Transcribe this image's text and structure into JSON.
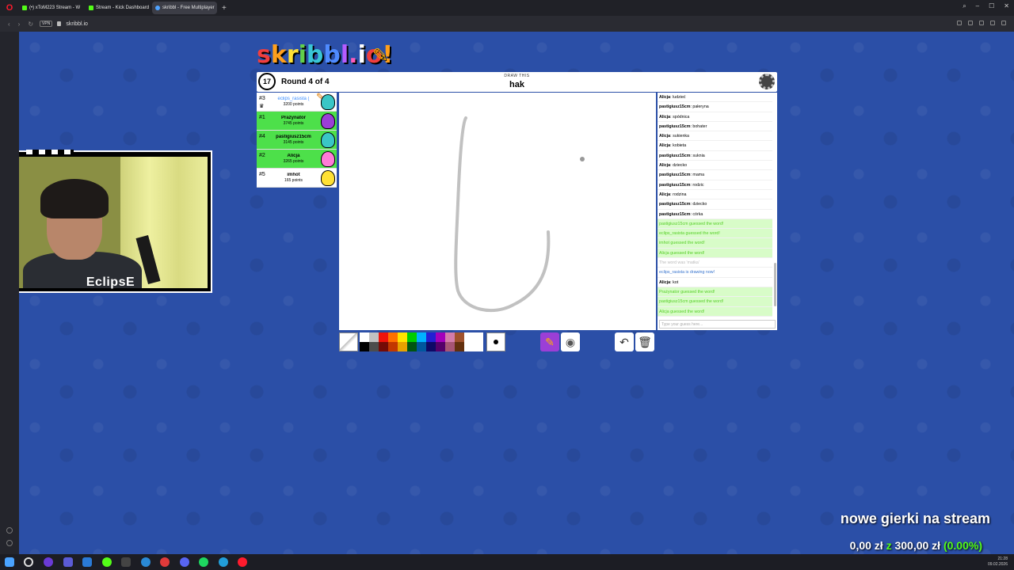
{
  "browser": {
    "tabs": [
      {
        "title": "(•) xToM223 Stream - W",
        "active": false
      },
      {
        "title": "Stream - Kick Dashboard",
        "active": false
      },
      {
        "title": "skribbl - Free Multiplayer",
        "active": true
      }
    ],
    "new_tab": "+",
    "vpn_label": "VPN",
    "url": "skribbl.io"
  },
  "game": {
    "logo_text": "skribbl.io",
    "timer": "17",
    "round_text": "Round 4 of 4",
    "draw_this_label": "DRAW THIS",
    "word": "hak",
    "players": [
      {
        "rank": "#3",
        "name": "eclips_rasista (",
        "points": "3200 points",
        "me": true,
        "drawing": true,
        "guessed": false,
        "avatar_color": "#3ac6c6"
      },
      {
        "rank": "#1",
        "name": "Prażynator",
        "points": "3745 points",
        "me": false,
        "drawing": false,
        "guessed": true,
        "avatar_color": "#9b3fd6"
      },
      {
        "rank": "#4",
        "name": "pastigiusz15cm",
        "points": "3145 points",
        "me": false,
        "drawing": false,
        "guessed": true,
        "avatar_color": "#3ac6c6"
      },
      {
        "rank": "#2",
        "name": "Alicja",
        "points": "3265 points",
        "me": false,
        "drawing": false,
        "guessed": true,
        "avatar_color": "#ff7bd6"
      },
      {
        "rank": "#5",
        "name": "imhot",
        "points": "165 points",
        "me": false,
        "drawing": false,
        "guessed": false,
        "avatar_color": "#ffe135"
      }
    ],
    "chat": [
      {
        "user": "Alicja",
        "text": "ludzieć",
        "type": "normal"
      },
      {
        "user": "pastigiusz15cm",
        "text": "pałeryna",
        "type": "normal"
      },
      {
        "user": "Alicja",
        "text": "spódnica",
        "type": "normal"
      },
      {
        "user": "pastigiusz15cm",
        "text": "bohater",
        "type": "normal"
      },
      {
        "user": "Alicja",
        "text": "sukienka",
        "type": "normal"
      },
      {
        "user": "Alicja",
        "text": "kobieta",
        "type": "normal"
      },
      {
        "user": "pastigiusz15cm",
        "text": "suknia",
        "type": "normal"
      },
      {
        "user": "Alicja",
        "text": "dziecko",
        "type": "normal"
      },
      {
        "user": "pastigiusz15cm",
        "text": "mama",
        "type": "normal"
      },
      {
        "user": "pastigiusz15cm",
        "text": "rodzic",
        "type": "normal"
      },
      {
        "user": "Alicja",
        "text": "rodzina",
        "type": "normal"
      },
      {
        "user": "pastigiusz15cm",
        "text": "dziecko",
        "type": "normal"
      },
      {
        "user": "pastigiusz15cm",
        "text": "córka",
        "type": "normal"
      },
      {
        "user": "",
        "text": "pastigiusz15cm guessed the word!",
        "type": "green"
      },
      {
        "user": "",
        "text": "eclips_rasista guessed the word!",
        "type": "green"
      },
      {
        "user": "",
        "text": "imhot guessed the word!",
        "type": "green"
      },
      {
        "user": "",
        "text": "Alicja guessed the word!",
        "type": "green"
      },
      {
        "user": "",
        "text": "The word was 'matka'",
        "type": "muted"
      },
      {
        "user": "",
        "text": "eclips_rasista is drawing now!",
        "type": "info"
      },
      {
        "user": "Alicja",
        "text": "kot",
        "type": "normal"
      },
      {
        "user": "",
        "text": "Prażynator guessed the word!",
        "type": "green"
      },
      {
        "user": "",
        "text": "pastigiusz15cm guessed the word!",
        "type": "green"
      },
      {
        "user": "",
        "text": "Alicja guessed the word!",
        "type": "green"
      }
    ],
    "chat_placeholder": "Type your guess here...",
    "palette_colors": [
      "#ffffff",
      "#c1c1c1",
      "#ef130b",
      "#ff7100",
      "#ffe400",
      "#00cc00",
      "#00b2ff",
      "#231fd3",
      "#a300ba",
      "#d37caa",
      "#a0522d",
      "#ffffff",
      "#ffffff",
      "#000000",
      "#4c4c4c",
      "#740b07",
      "#c23800",
      "#e8a200",
      "#005510",
      "#00569e",
      "#0e0865",
      "#550069",
      "#a75574",
      "#63300d",
      "#ffffff",
      "#ffffff"
    ]
  },
  "webcam": {
    "streamer_name": "EclipsE"
  },
  "overlay": {
    "title": "nowe gierki na stream",
    "goal_current": "0,00 zł",
    "goal_sep": "z",
    "goal_target": "300,00 zł",
    "goal_percent": "(0.00%)"
  },
  "taskbar": {
    "time": "21:28",
    "date": "09.02.2026"
  }
}
